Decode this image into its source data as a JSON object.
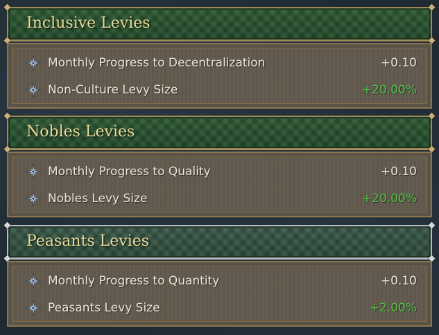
{
  "panels": [
    {
      "title": "Inclusive Levies",
      "rows": [
        {
          "icon": "compass-star-icon",
          "label": "Monthly Progress to Decentralization",
          "value": "+0.10",
          "value_color": "#ece6d8"
        },
        {
          "icon": "compass-star-icon",
          "label": "Non-Culture Levy Size",
          "value": "+20.00%",
          "value_color": "#4fc24a"
        }
      ]
    },
    {
      "title": "Nobles Levies",
      "rows": [
        {
          "icon": "compass-star-icon",
          "label": "Monthly Progress to Quality",
          "value": "+0.10",
          "value_color": "#ece6d8"
        },
        {
          "icon": "compass-star-icon",
          "label": "Nobles Levy Size",
          "value": "+20.00%",
          "value_color": "#4fc24a"
        }
      ]
    },
    {
      "title": "Peasants Levies",
      "rows": [
        {
          "icon": "compass-star-icon",
          "label": "Monthly Progress to Quantity",
          "value": "+0.10",
          "value_color": "#ece6d8"
        },
        {
          "icon": "compass-star-icon",
          "label": "Peasants Levy Size",
          "value": "+2.00%",
          "value_color": "#4fc24a"
        }
      ]
    }
  ],
  "colors": {
    "title_gold": "#e8dc9a",
    "positive_green": "#4fc24a",
    "header_green": "#2f5a34"
  }
}
